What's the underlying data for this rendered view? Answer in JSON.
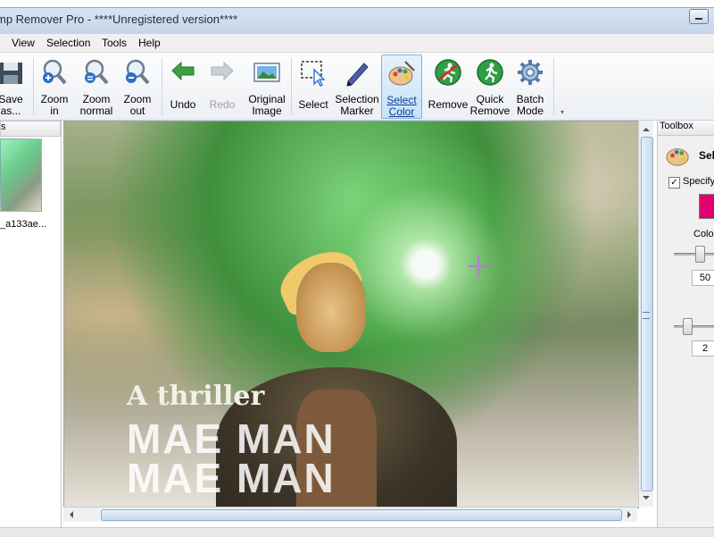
{
  "window": {
    "title": "mp Remover Pro - ****Unregistered version****"
  },
  "menu": [
    "View",
    "Selection",
    "Tools",
    "Help"
  ],
  "toolbar": {
    "save_as": [
      "Save",
      "as..."
    ],
    "zoom_in": [
      "Zoom",
      "in"
    ],
    "zoom_normal": [
      "Zoom",
      "normal"
    ],
    "zoom_out": [
      "Zoom",
      "out"
    ],
    "undo": "Undo",
    "redo": "Redo",
    "original_image": [
      "Original",
      "Image"
    ],
    "select": "Select",
    "selection_marker": [
      "Selection",
      "Marker"
    ],
    "select_color": [
      "Select",
      "Color"
    ],
    "remove": "Remove",
    "quick_remove": [
      "Quick",
      "Remove"
    ],
    "batch_mode": [
      "Batch",
      "Mode"
    ]
  },
  "left_panel": {
    "header": "s",
    "thumbnail_caption": "_a133ae..."
  },
  "image_text": {
    "line1": "A thriller",
    "line2": "MAE   MAN",
    "line3": "MAE   MAN"
  },
  "toolbox": {
    "header": "Toolbox",
    "title": "Sele",
    "checkbox_label": "Specify s",
    "checkbox_checked": true,
    "swatch_color": "#e0006e",
    "color_label": "Color",
    "slider1_value": "50",
    "slider2_value": "2"
  },
  "colors": {
    "accent": "#7fb1e0",
    "swatch": "#e0006e"
  }
}
